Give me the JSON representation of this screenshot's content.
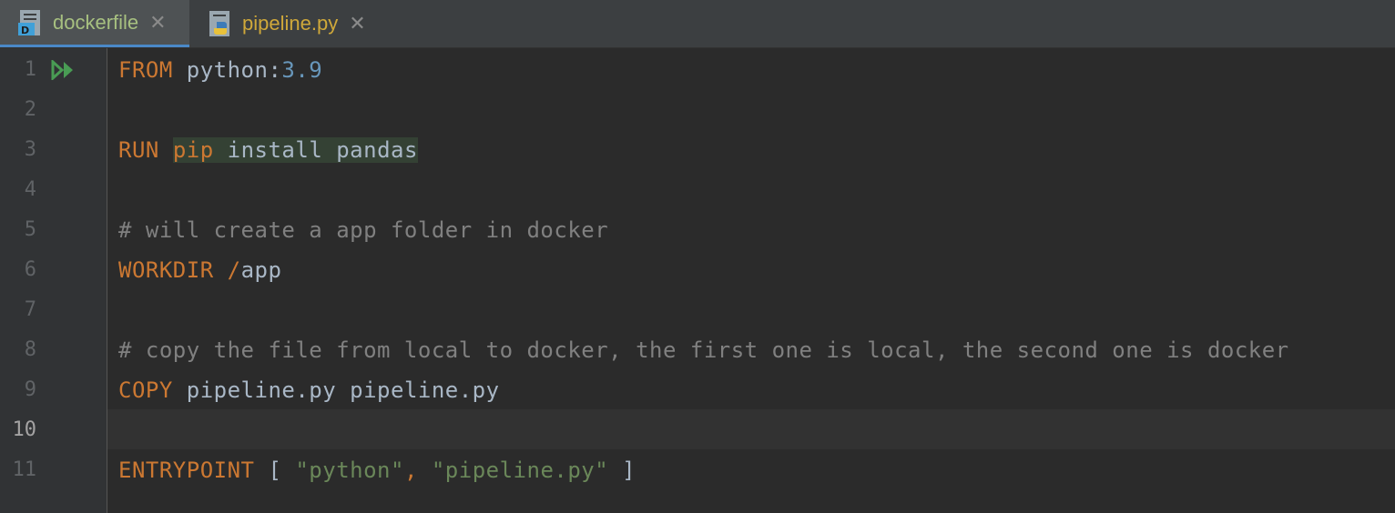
{
  "tabs": [
    {
      "label": "dockerfile",
      "icon": "dockerfile-icon",
      "active": true
    },
    {
      "label": "pipeline.py",
      "icon": "python-file-icon",
      "active": false
    }
  ],
  "tab_close_glyph": "✕",
  "file_icon_letter": "D",
  "line_numbers": [
    "1",
    "2",
    "3",
    "4",
    "5",
    "6",
    "7",
    "8",
    "9",
    "10",
    "11"
  ],
  "code": {
    "l1": {
      "kw": "FROM",
      "img": "python:",
      "ver": "3.9"
    },
    "l3": {
      "kw": "RUN",
      "cmd": "pip",
      "rest": "install pandas"
    },
    "l5": {
      "comment": "# will create a app folder in docker"
    },
    "l6": {
      "kw": "WORKDIR",
      "slash": "/",
      "path": "app"
    },
    "l8": {
      "comment": "# copy the file from local to docker, the first one is local, the second one is docker"
    },
    "l9": {
      "kw": "COPY",
      "args": "pipeline.py pipeline.py"
    },
    "l11": {
      "kw": "ENTRYPOINT",
      "open": "[",
      "s1": "\"python\"",
      "comma": ",",
      "s2": "\"pipeline.py\"",
      "close": "]"
    }
  },
  "colors": {
    "keyword": "#cc7832",
    "string": "#6a8759",
    "number": "#6897bb",
    "comment": "#808080",
    "text": "#a9b7c6"
  }
}
